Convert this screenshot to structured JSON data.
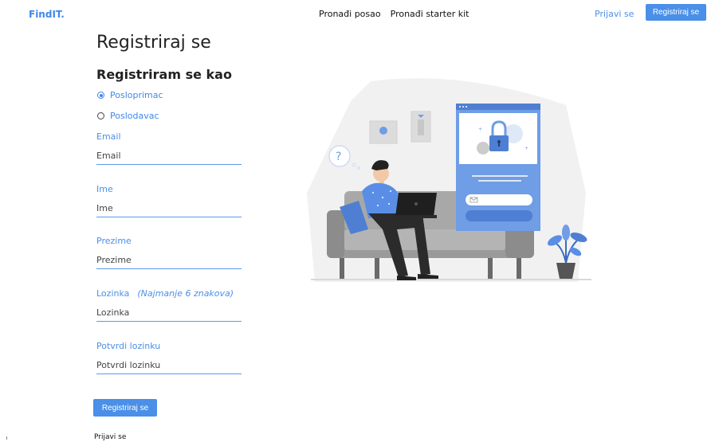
{
  "header": {
    "logo": "FindIT.",
    "nav": [
      "Pronađi posao",
      "Pronađi starter kit"
    ],
    "login_label": "Prijavi se",
    "signup_label": "Registriraj se"
  },
  "form": {
    "title": "Registriraj se",
    "subtitle": "Registriram se kao",
    "roles": [
      {
        "label": "Posloprimac",
        "selected": true
      },
      {
        "label": "Poslodavac",
        "selected": false
      }
    ],
    "fields": {
      "email": {
        "label": "Email",
        "placeholder": "Email",
        "value": ""
      },
      "first_name": {
        "label": "Ime",
        "placeholder": "Ime",
        "value": ""
      },
      "last_name": {
        "label": "Prezime",
        "placeholder": "Prezime",
        "value": ""
      },
      "password": {
        "label": "Lozinka",
        "hint": "(Najmanje 6 znakova)",
        "placeholder": "Lozinka",
        "value": ""
      },
      "confirm_password": {
        "label": "Potvrdi lozinku",
        "placeholder": "Potvrdi lozinku",
        "value": ""
      }
    },
    "submit_label": "Registriraj se",
    "login_link": "Prijavi se"
  },
  "colors": {
    "accent": "#4a8fe8",
    "illustration_blue": "#6f9de6",
    "sofa_gray": "#8c8c8c",
    "bg_blob": "#f1f1f1"
  },
  "icons": [
    "question-mark-icon",
    "padlock-icon",
    "envelope-icon"
  ]
}
